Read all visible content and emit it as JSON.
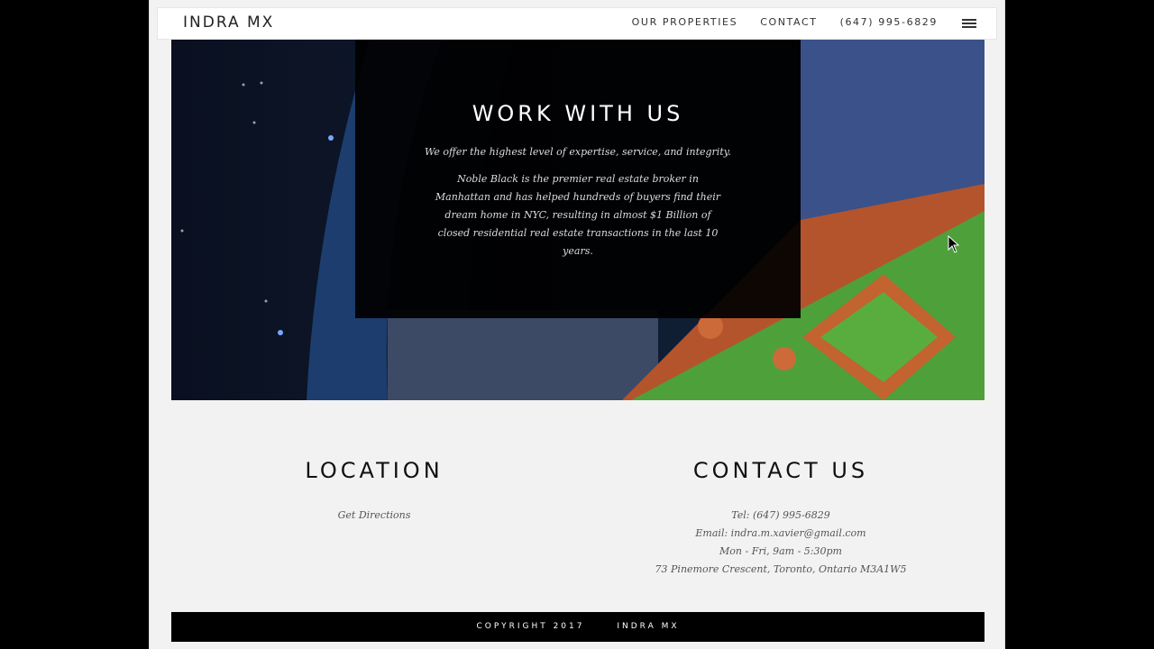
{
  "header": {
    "logo": "INDRA MX",
    "nav": [
      "OUR PROPERTIES",
      "CONTACT",
      "(647) 995-6829"
    ],
    "menu_icon": "hamburger-icon"
  },
  "hero": {
    "title": "WORK WITH US",
    "subtitle": "We offer the highest level of expertise, service, and integrity.",
    "body": "Noble Black is the premier real estate broker in Manhattan and has helped hundreds of buyers find their dream home in NYC, resulting in almost $1 Billion of closed residential real estate transactions in the last 10 years."
  },
  "location": {
    "title": "LOCATION",
    "link": "Get Directions"
  },
  "contact": {
    "title": "CONTACT US",
    "lines": [
      "Tel: (647) 995-6829",
      "Email: indra.m.xavier@gmail.com",
      "Mon - Fri, 9am - 5:30pm",
      "73 Pinemore Crescent, Toronto, Ontario M3A1W5"
    ]
  },
  "footer": {
    "copyright": "COPYRIGHT 2017",
    "brand": "INDRA MX"
  }
}
